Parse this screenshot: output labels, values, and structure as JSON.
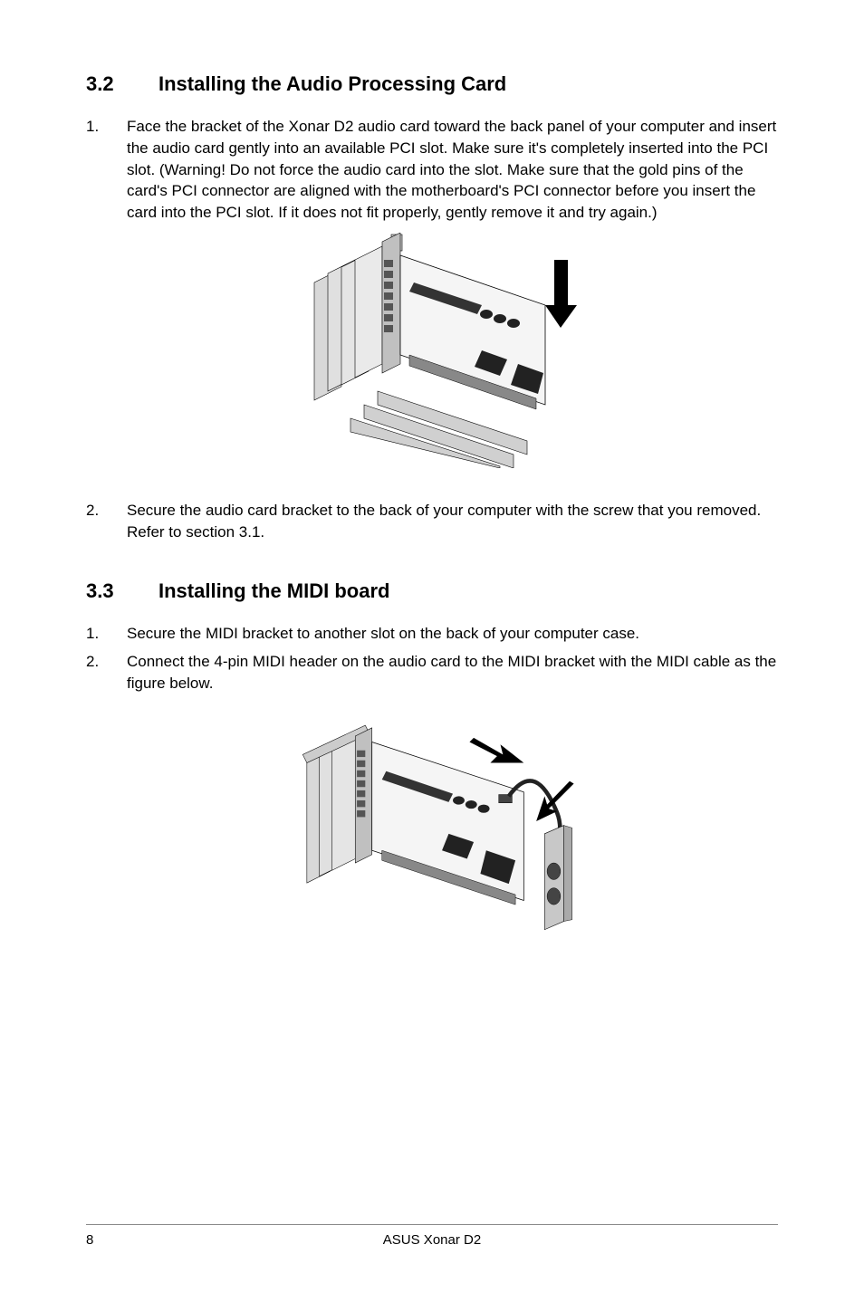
{
  "sections": {
    "s32": {
      "num": "3.2",
      "title": "Installing the Audio Processing Card",
      "items": [
        {
          "num": "1.",
          "text": "Face the bracket of the Xonar D2 audio card toward the back panel of your computer and insert the audio card gently into an available PCI slot. Make sure it's completely inserted into the PCI slot. (Warning! Do not force the audio card into the slot. Make sure that the gold pins of the card's PCI connector are aligned with the motherboard's PCI connector before you insert the card into the PCI slot. If it does not fit properly, gently remove it and try again.)"
        },
        {
          "num": "2.",
          "text": "Secure the audio card bracket to the back of your computer with the screw that you removed. Refer to section 3.1."
        }
      ]
    },
    "s33": {
      "num": "3.3",
      "title": "Installing the MIDI board",
      "items": [
        {
          "num": "1.",
          "text": "Secure the MIDI bracket to another slot on the back of your computer case."
        },
        {
          "num": "2.",
          "text": "Connect the 4-pin MIDI header on the audio card to the MIDI bracket with the MIDI cable as the figure below."
        }
      ]
    }
  },
  "footer": {
    "page": "8",
    "title": "ASUS Xonar D2"
  }
}
